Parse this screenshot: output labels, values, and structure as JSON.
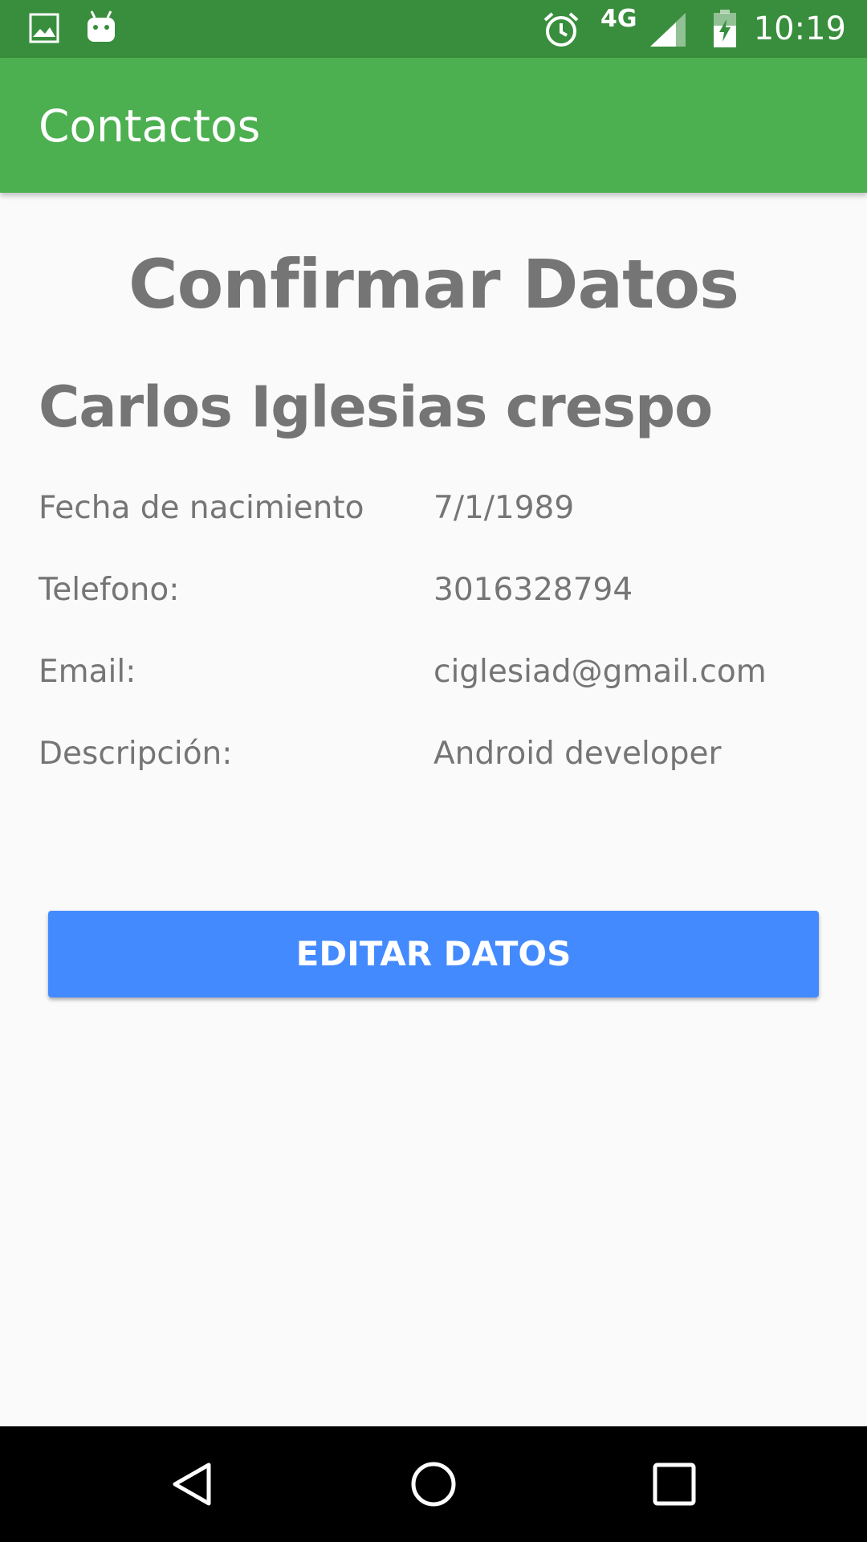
{
  "status_bar": {
    "time": "10:19",
    "network": "4G",
    "icons": [
      "gallery-icon",
      "android-icon",
      "alarm-icon",
      "signal-icon",
      "battery-charging-icon"
    ]
  },
  "app_bar": {
    "title": "Contactos",
    "color": "#4caf50",
    "status_color": "#388e3c"
  },
  "main": {
    "heading": "Confirmar Datos",
    "name": "Carlos Iglesias crespo",
    "fields": [
      {
        "label": "Fecha de nacimiento",
        "value": "7/1/1989"
      },
      {
        "label": "Telefono:",
        "value": "3016328794"
      },
      {
        "label": "Email:",
        "value": "ciglesiad@gmail.com"
      },
      {
        "label": "Descripción:",
        "value": "Android developer"
      }
    ],
    "edit_button_label": "EDITAR DATOS",
    "button_color": "#448aff"
  },
  "nav_bar": {
    "icons": [
      "back-icon",
      "home-icon",
      "recents-icon"
    ]
  }
}
